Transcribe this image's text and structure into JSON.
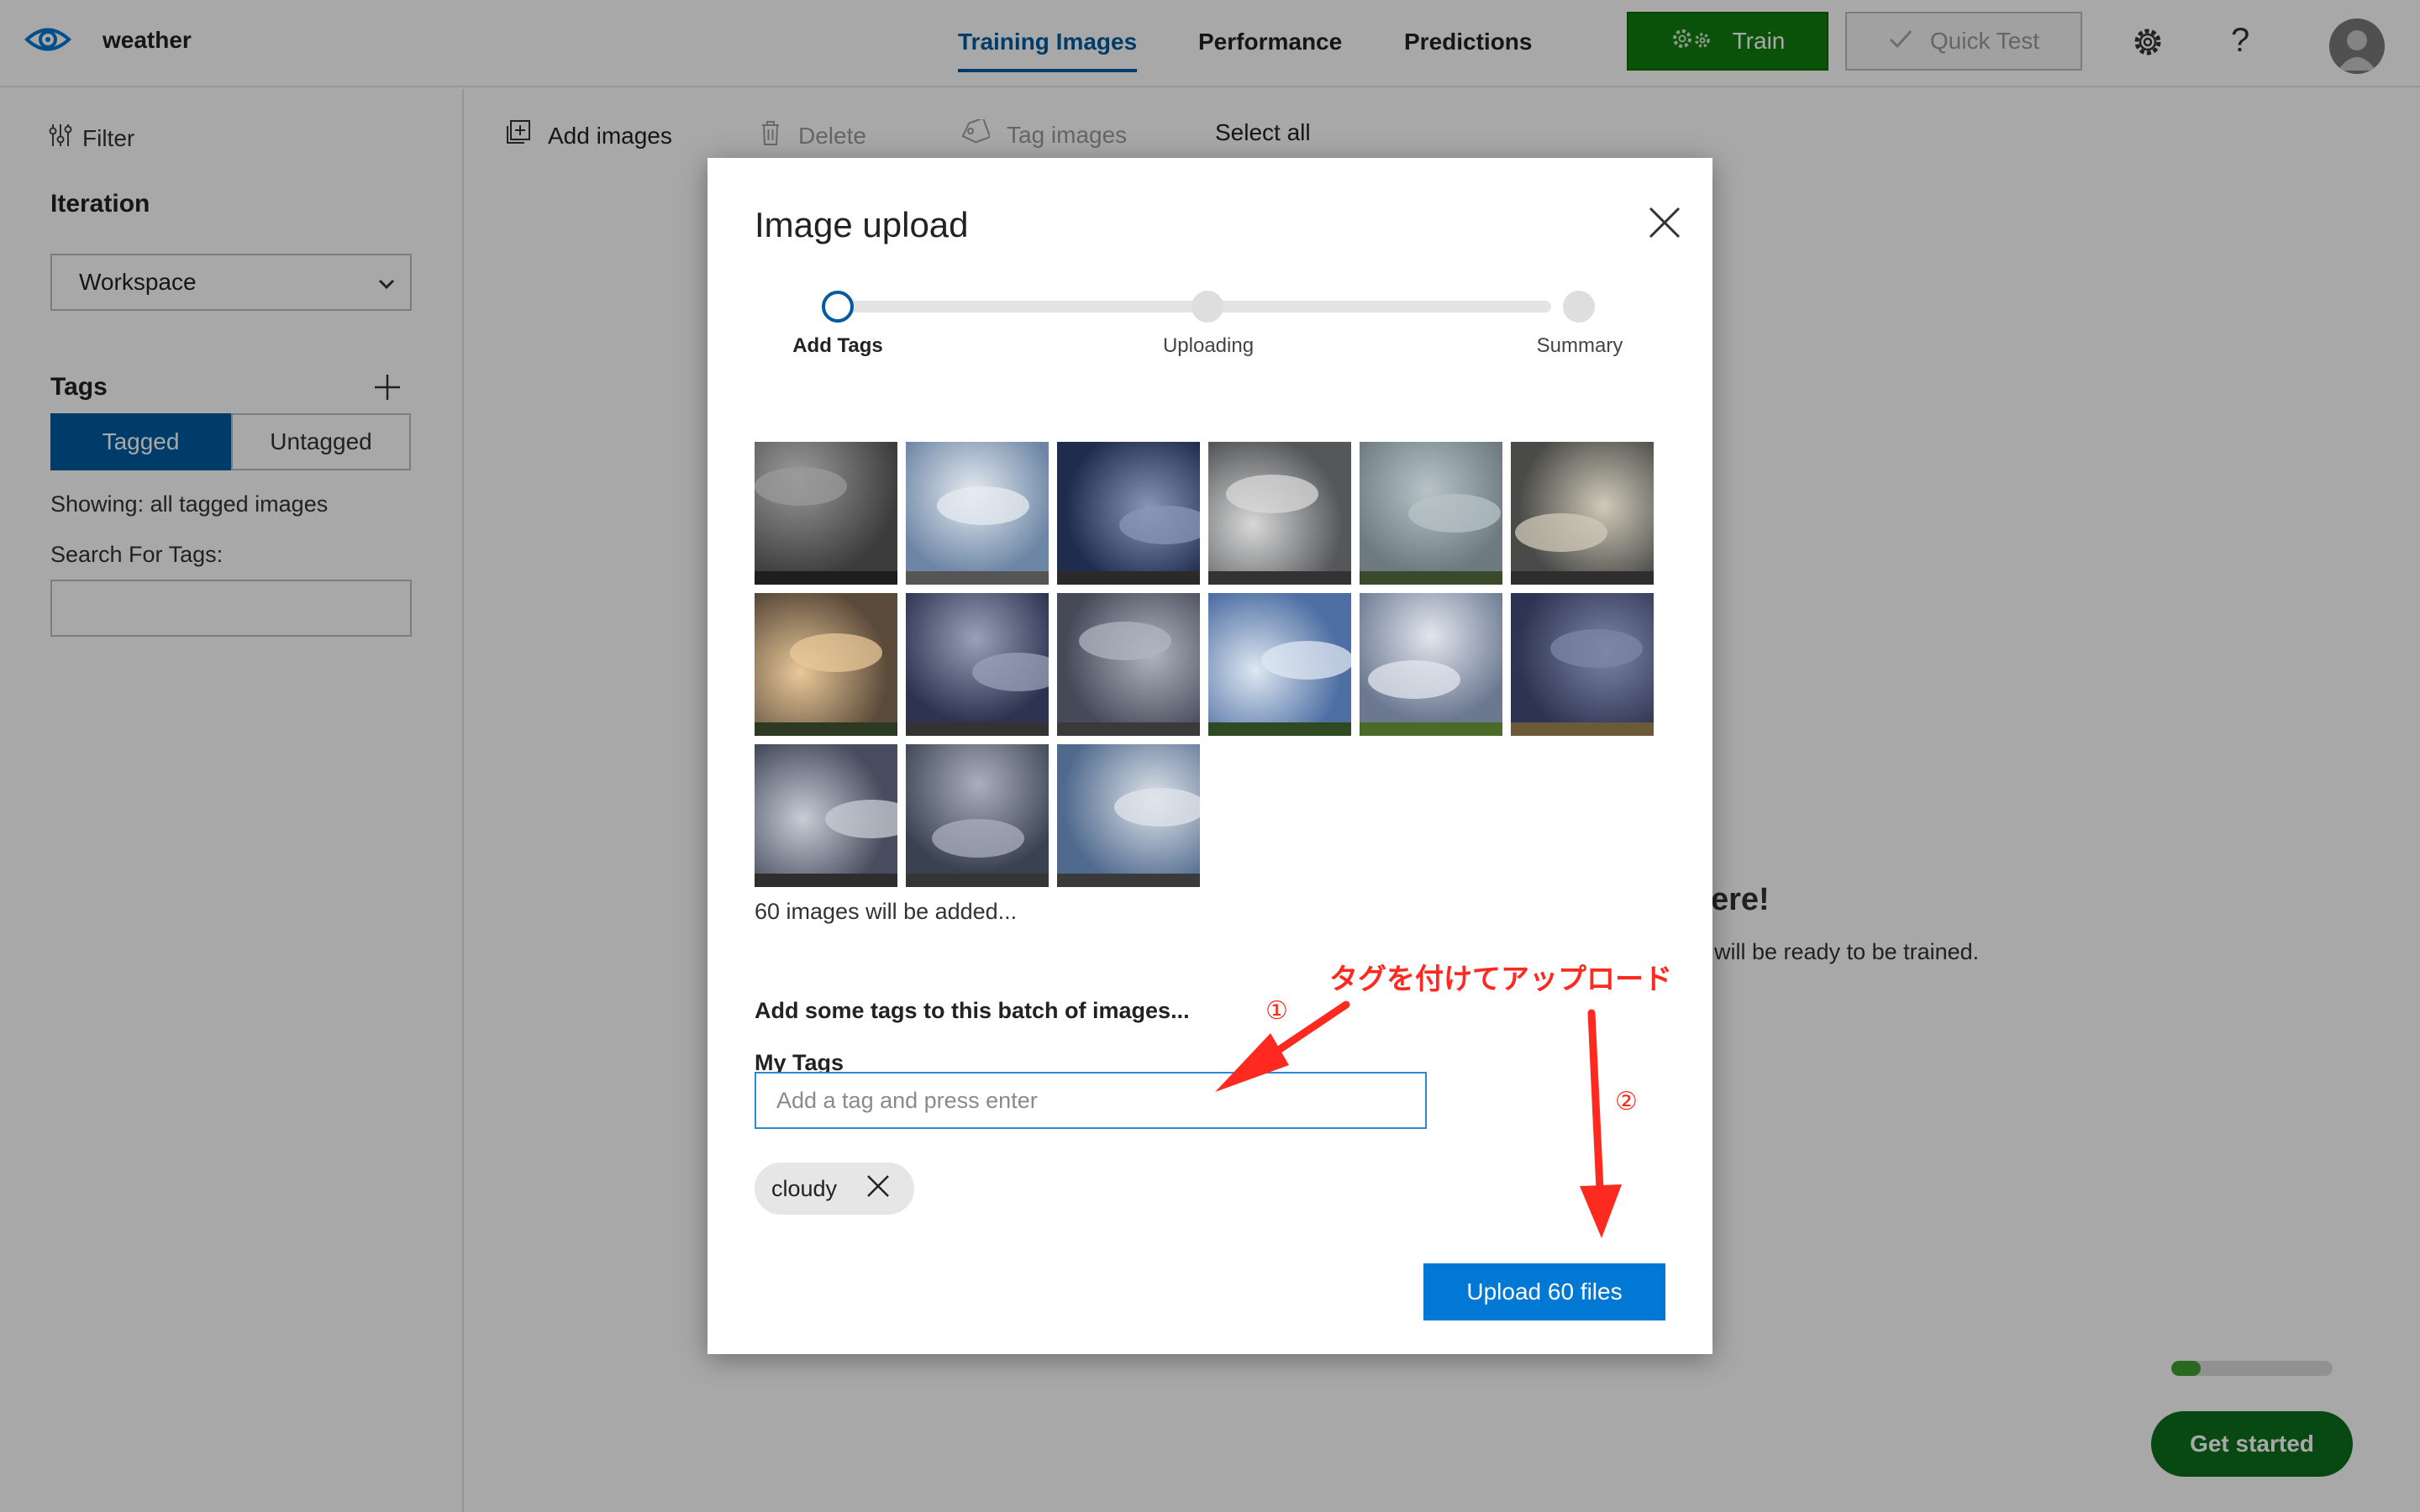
{
  "header": {
    "project_name": "weather",
    "tabs": [
      {
        "label": "Training Images",
        "active": true
      },
      {
        "label": "Performance",
        "active": false
      },
      {
        "label": "Predictions",
        "active": false
      }
    ],
    "train_label": "Train",
    "quick_test_label": "Quick Test",
    "help_label": "?"
  },
  "sidebar": {
    "filter_label": "Filter",
    "iteration_heading": "Iteration",
    "iteration_selected": "Workspace",
    "tags_heading": "Tags",
    "tagged_label": "Tagged",
    "untagged_label": "Untagged",
    "showing_text": "Showing: all tagged images",
    "search_label": "Search For Tags:"
  },
  "toolbar": {
    "add_images": "Add images",
    "delete": "Delete",
    "tag_images": "Tag images",
    "select_all": "Select all"
  },
  "background": {
    "hint_title": "ere!",
    "hint_text": "will be ready to be trained.",
    "progress_fraction": 0.18,
    "get_started_label": "Get started"
  },
  "modal": {
    "title": "Image upload",
    "steps": [
      "Add Tags",
      "Uploading",
      "Summary"
    ],
    "current_step": 0,
    "thumbnail_count_visible": 15,
    "count_text": "60 images will be added...",
    "add_tags_heading": "Add some tags to this batch of images...",
    "my_tags_label": "My Tags",
    "tag_input_placeholder": "Add a tag and press enter",
    "tags": [
      "cloudy"
    ],
    "upload_label": "Upload 60 files"
  },
  "annotations": {
    "main_text": "タグを付けてアップロード",
    "step1": "①",
    "step2": "②",
    "color": "#ff2a1f"
  },
  "colors": {
    "accent": "#005ba1",
    "primary_button": "#0078d4",
    "train_green": "#107c10"
  }
}
